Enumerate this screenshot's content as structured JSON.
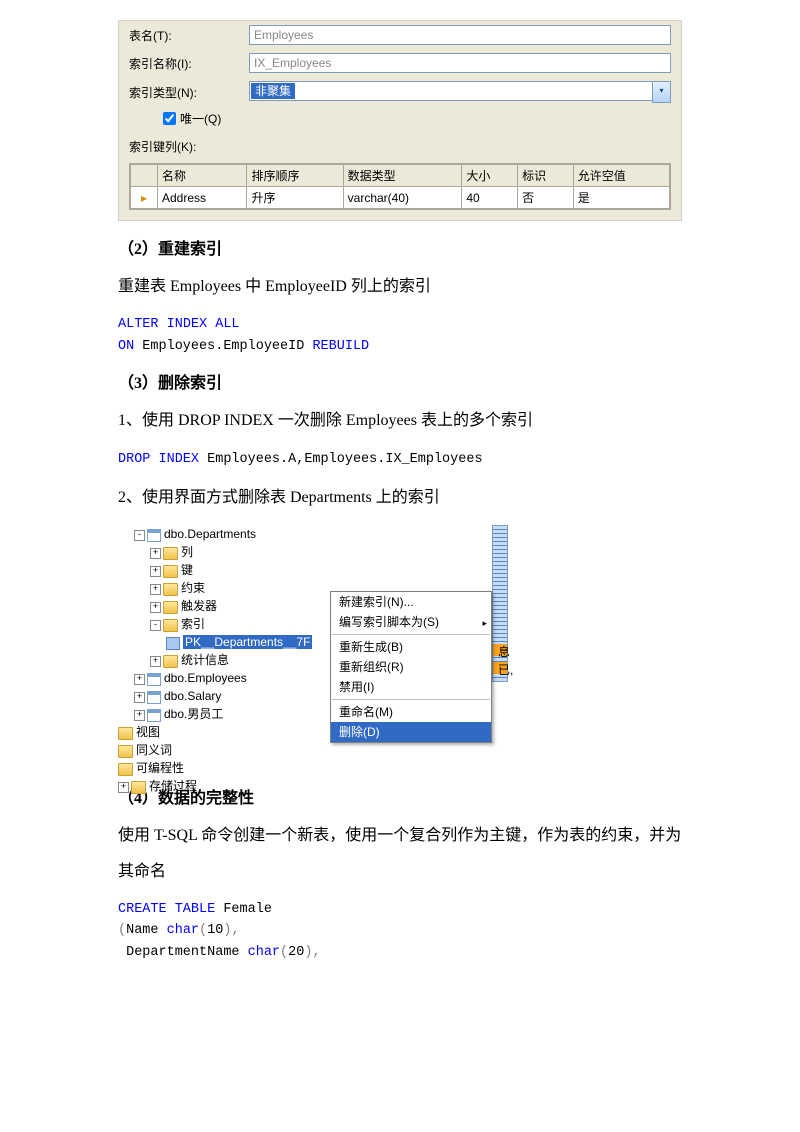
{
  "dialog": {
    "rows": {
      "tableName": {
        "label": "表名(T):",
        "value": "Employees"
      },
      "indexName": {
        "label": "索引名称(I):",
        "value": "IX_Employees"
      },
      "indexType": {
        "label": "索引类型(N):",
        "value": "非聚集"
      },
      "unique": {
        "label": "唯一(Q)"
      },
      "indexCols": {
        "label": "索引键列(K):"
      }
    },
    "table": {
      "headers": [
        "名称",
        "排序顺序",
        "数据类型",
        "大小",
        "标识",
        "允许空值"
      ],
      "row": {
        "name": "Address",
        "sort": "升序",
        "type": "varchar(40)",
        "size": "40",
        "identity": "否",
        "nullable": "是"
      }
    }
  },
  "section2": {
    "heading": "（2）重建索引",
    "body": "重建表 Employees 中 EmployeeID 列上的索引",
    "sql": {
      "l1a": "ALTER",
      "l1b": " INDEX",
      "l1c": " ALL",
      "l2a": "ON",
      "l2b": " Employees.EmployeeID ",
      "l2c": "REBUILD"
    }
  },
  "section3": {
    "heading": "（3）删除索引",
    "body1": "1、使用 DROP INDEX 一次删除 Employees 表上的多个索引",
    "sql1": {
      "a": "DROP",
      "b": " INDEX",
      "c": " Employees.A,Employees.IX_Employees"
    },
    "body2": "2、使用界面方式删除表 Departments 上的索引"
  },
  "tree": {
    "n0": "dbo.Departments",
    "c1": "列",
    "c2": "键",
    "c3": "约束",
    "c4": "触发器",
    "c5": "索引",
    "idx": "PK__Departments__7F",
    "c6": "统计信息",
    "t2": "dbo.Employees",
    "t3": "dbo.Salary",
    "t4": "dbo.男员工",
    "f1": "视图",
    "f2": "同义词",
    "f3": "可编程性",
    "f4": "存储过程",
    "side1": "息",
    "side2": "已,"
  },
  "contextMenu": {
    "m1": "新建索引(N)...",
    "m2": "编写索引脚本为(S)",
    "m3": "重新生成(B)",
    "m4": "重新组织(R)",
    "m5": "禁用(I)",
    "m6": "重命名(M)",
    "m7": "删除(D)"
  },
  "section4": {
    "heading": "（4）数据的完整性",
    "body": "使用 T-SQL 命令创建一个新表，使用一个复合列作为主键，作为表的约束，并为其命名",
    "sql": {
      "l1a": "CREATE",
      "l1b": " TABLE",
      "l1c": " Female",
      "l2a": "(",
      "l2b": "Name ",
      "l2c": "char",
      "l2d": "(",
      "l2e": "10",
      "l2f": "),",
      "l3a": " DepartmentName ",
      "l3b": "char",
      "l3c": "(",
      "l3d": "20",
      "l3e": "),"
    }
  }
}
